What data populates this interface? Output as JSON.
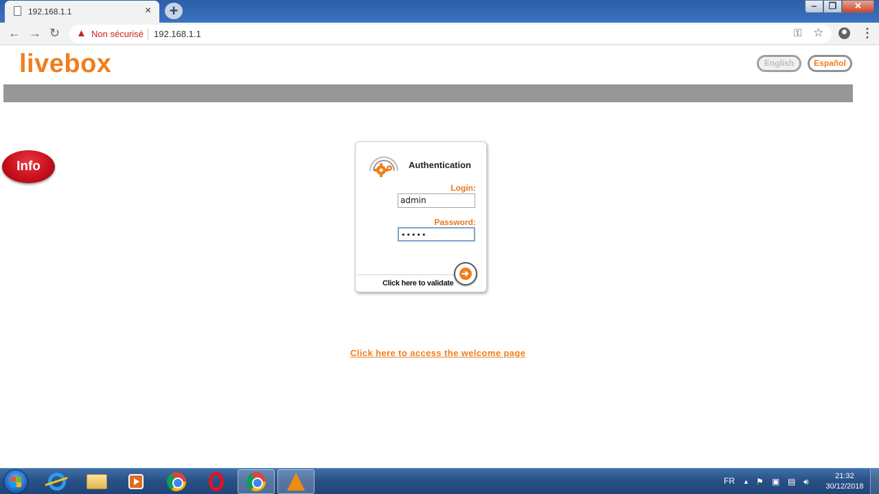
{
  "browser": {
    "tab_title": "192.168.1.1",
    "tab_close": "×",
    "new_tab": "+",
    "security_label": "Non sécurisé",
    "url": "192.168.1.1",
    "window_minimize": "‒",
    "window_restore": "❐",
    "window_close": "✕"
  },
  "page": {
    "logo": "livebox",
    "languages": [
      {
        "label": "English",
        "active": false
      },
      {
        "label": "Español",
        "active": true
      }
    ],
    "info_badge": "Info",
    "auth": {
      "title": "Authentication",
      "login_label": "Login:",
      "login_value": "admin",
      "password_label": "Password:",
      "password_value": "•••••",
      "validate_label": "Click here to validate",
      "validate_arrow": "➔"
    },
    "welcome_link": "Click here to access the welcome page"
  },
  "colors": {
    "accent": "#f07e1b",
    "header_bar": "#979797",
    "info_red": "#c8101c"
  },
  "taskbar": {
    "apps": [
      "internet-explorer",
      "file-explorer",
      "media-player",
      "chrome",
      "opera",
      "chrome-active",
      "vlc"
    ],
    "input_language": "FR",
    "tray_arrow": "▲",
    "time": "21:32",
    "date": "30/12/2018"
  }
}
